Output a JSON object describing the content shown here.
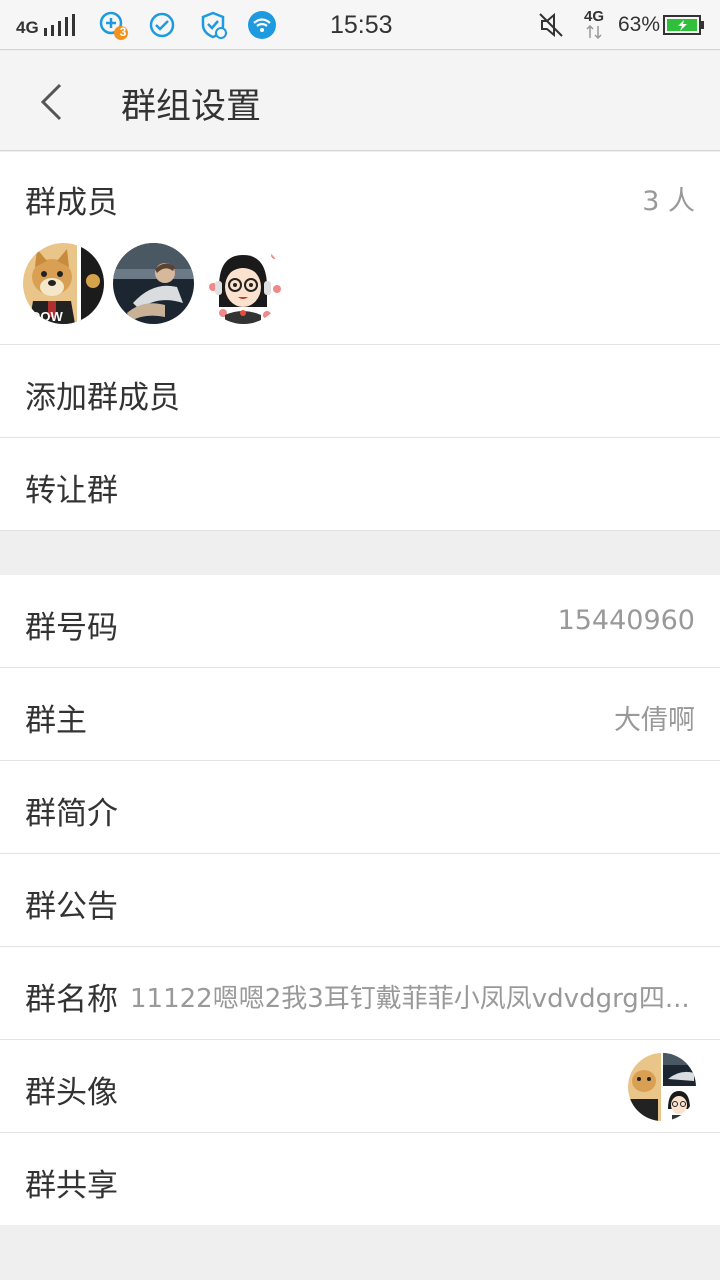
{
  "status_bar": {
    "network_left": "4G",
    "notification_badge": "3",
    "time": "15:53",
    "network_right": "4G",
    "battery_percent": "63%",
    "icons": [
      "signal-icon",
      "add-notification-icon",
      "check-circle-icon",
      "shield-clock-icon",
      "wifi-icon",
      "mute-icon",
      "data-arrows-icon",
      "battery-charging-icon"
    ],
    "colors": {
      "accent_blue": "#1e9ae0",
      "badge_orange": "#f5921e",
      "battery_green": "#2fbf3b"
    }
  },
  "header": {
    "back_icon": "chevron-left-icon",
    "title": "群组设置"
  },
  "members": {
    "label": "群成员",
    "count": "3 人",
    "avatars": [
      "avatar-dog",
      "avatar-boy",
      "avatar-girl"
    ]
  },
  "section1": {
    "add_member": "添加群成员",
    "transfer": "转让群"
  },
  "section2": {
    "group_number_label": "群号码",
    "group_number_value": "15440960",
    "owner_label": "群主",
    "owner_value": "大倩啊",
    "intro_label": "群简介",
    "announcement_label": "群公告",
    "name_label": "群名称",
    "name_value": "11122嗯嗯2我3耳钉戴菲菲小凤凤vdvdgrg四...",
    "avatar_label": "群头像",
    "share_label": "群共享"
  }
}
